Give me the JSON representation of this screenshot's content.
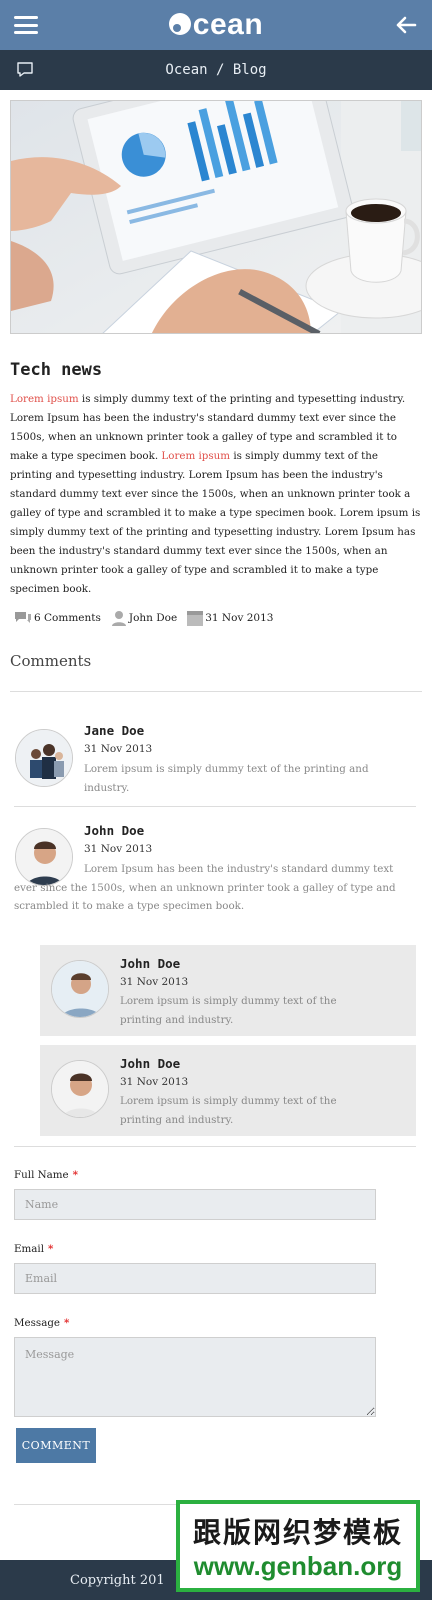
{
  "header": {
    "logo_text": "cean",
    "breadcrumb": "Ocean / Blog"
  },
  "article": {
    "title": "Tech news",
    "body_parts": [
      {
        "text": "Lorem ipsum",
        "red": true
      },
      {
        "text": " is simply dummy text of the printing and typesetting industry. Lorem Ipsum has been the industry's standard dummy text ever since the 1500s, when an unknown printer took a galley of type and scrambled it to make a type specimen book. ",
        "red": false
      },
      {
        "text": "Lorem ipsum",
        "red": true
      },
      {
        "text": " is simply dummy text of the printing and typesetting industry. Lorem Ipsum has been the industry's standard dummy text ever since the 1500s, when an unknown printer took a galley of type and scrambled it to make a type specimen book. Lorem ipsum is simply dummy text of the printing and typesetting industry. Lorem Ipsum has been the industry's standard dummy text ever since the 1500s, when an unknown printer took a galley of type and scrambled it to make a type specimen book.",
        "red": false
      }
    ],
    "meta": {
      "comments": "6 Comments",
      "author": "John Doe",
      "date": "31 Nov 2013"
    }
  },
  "comments_section": {
    "title": "Comments",
    "items": [
      {
        "name": "Jane Doe",
        "date": "31 Nov 2013",
        "text": "Lorem ipsum is simply dummy text of the printing and industry."
      },
      {
        "name": "John Doe",
        "date": "31 Nov 2013",
        "text": "Lorem Ipsum has been the industry's standard dummy text ever since the 1500s, when an unknown printer took a galley of type and scrambled it to make a type specimen book."
      },
      {
        "name": "John Doe",
        "date": "31 Nov 2013",
        "text": "Lorem ipsum is simply dummy text of the printing and industry."
      },
      {
        "name": "John Doe",
        "date": "31 Nov 2013",
        "text": "Lorem ipsum is simply dummy text of the printing and industry."
      }
    ]
  },
  "form": {
    "fullname_label": "Full Name",
    "fullname_placeholder": "Name",
    "email_label": "Email",
    "email_placeholder": "Email",
    "message_label": "Message",
    "message_placeholder": "Message",
    "required_mark": "*",
    "submit_label": "COMMENT"
  },
  "footer": {
    "copyright": "Copyright 201"
  },
  "watermark": {
    "line1": "跟版网织梦模板",
    "line2": "www.genban.org"
  },
  "colors": {
    "header": "#5b7fa8",
    "subbar": "#2b3a4a",
    "accent_red": "#e0504a",
    "button": "#4d79a5"
  }
}
